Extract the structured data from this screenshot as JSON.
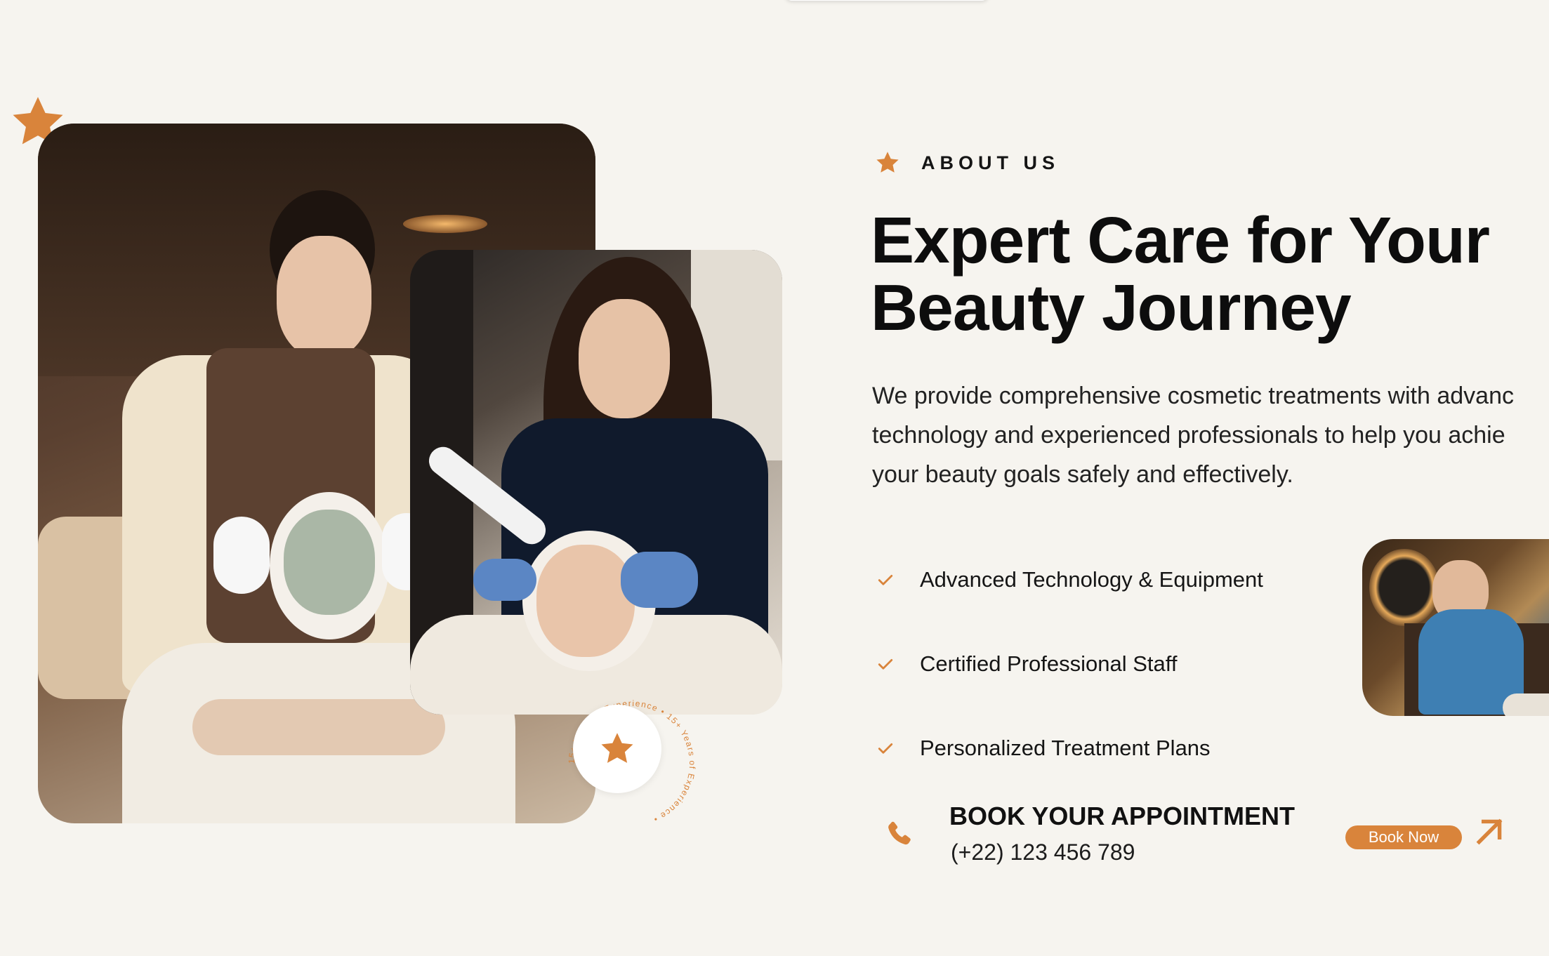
{
  "about": {
    "label": "ABOUT US",
    "heading": "Expert Care for Your Beauty Journey",
    "description_lines": [
      "We provide comprehensive cosmetic treatments with advanc",
      "technology and experienced professionals to help you achie",
      "your beauty goals safely and effectively."
    ]
  },
  "features": [
    "Advanced Technology & Equipment",
    "Certified Professional Staff",
    "Personalized Treatment Plans"
  ],
  "badge": {
    "ring_text": "15+ Years of Experience • 15+ Years of Experience •"
  },
  "booking": {
    "title": "BOOK YOUR APPOINTMENT",
    "phone": "(+22) 123 456 789",
    "button_label": "Book Now"
  },
  "icons": {
    "star": "star-icon",
    "check": "check-icon",
    "phone": "phone-icon",
    "arrow": "arrow-up-right-icon"
  },
  "colors": {
    "accent": "#d9843b",
    "background": "#f6f4ef",
    "text": "#0d0d0d"
  }
}
